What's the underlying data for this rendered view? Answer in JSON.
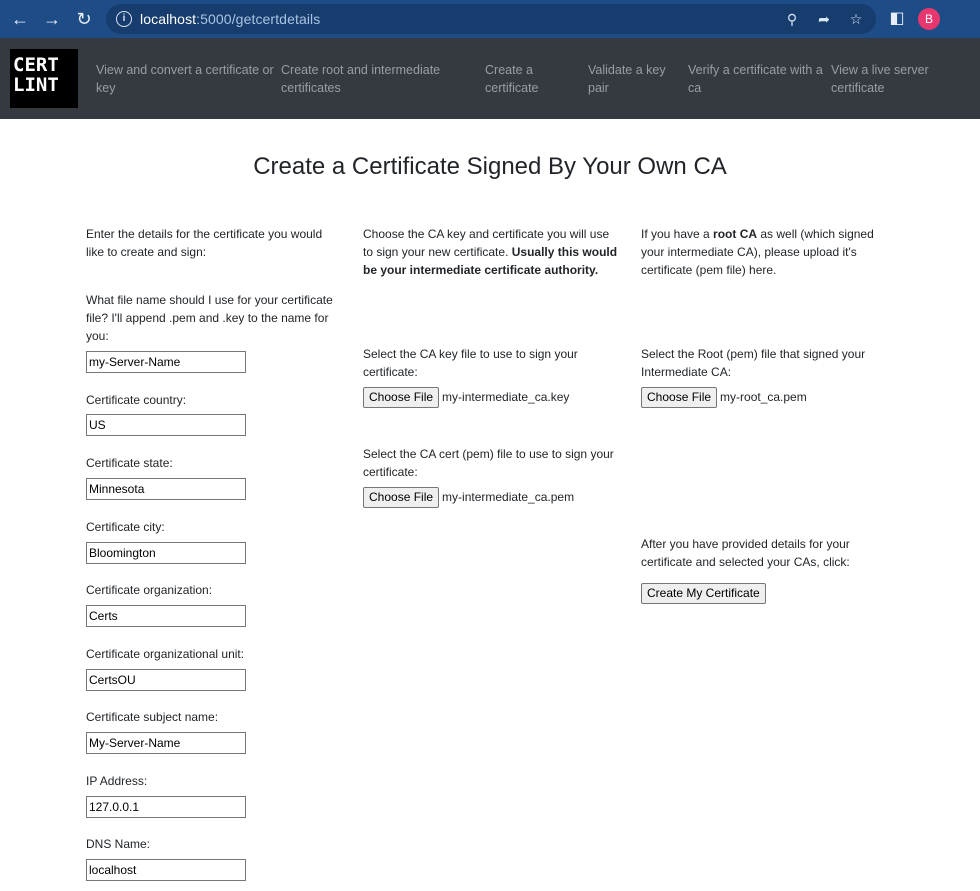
{
  "browser": {
    "url_host": "localhost",
    "url_path": ":5000/getcertdetails",
    "icons": [
      "back-icon",
      "forward-icon",
      "reload-icon",
      "site-info-icon",
      "zoom-icon",
      "share-icon",
      "bookmark-star-icon",
      "side-panel-icon"
    ],
    "profile_initial": "B",
    "profile_color": "#e8376f",
    "chrome_color": "#1e4c86"
  },
  "navbar": {
    "logo_line1": "CERT",
    "logo_line2": "LINT",
    "links": [
      {
        "line1": "View and convert a certificate or",
        "line2": "key"
      },
      {
        "line1": "Create root and intermediate",
        "line2": "certificates"
      },
      {
        "line1": "Create a",
        "line2": "certificate"
      },
      {
        "line1": "Validate a key",
        "line2": "pair"
      },
      {
        "line1": "Verify a certificate with a",
        "line2": "ca"
      },
      {
        "line1": "View a live server",
        "line2": "certificate"
      }
    ],
    "background": "#343a40"
  },
  "page": {
    "title": "Create a Certificate Signed By Your Own CA"
  },
  "left": {
    "intro_l1": "Enter the details for the certificate you would",
    "intro_l2": "like to create and sign:",
    "filename_l1": "What file name should I use for your certificate",
    "filename_l2": "file? I'll append .pem and .key to the name for",
    "filename_l3": "you:",
    "filename_value": "my-Server-Name",
    "fields": [
      {
        "label": "Certificate country:",
        "value": "US"
      },
      {
        "label": "Certificate state:",
        "value": "Minnesota"
      },
      {
        "label": "Certificate city:",
        "value": "Bloomington"
      },
      {
        "label": "Certificate organization:",
        "value": "Certs"
      },
      {
        "label": "Certificate organizational unit:",
        "value": "CertsOU"
      },
      {
        "label": "Certificate subject name:",
        "value": "My-Server-Name"
      },
      {
        "label": "IP Address:",
        "value": "127.0.0.1"
      },
      {
        "label": "DNS Name:",
        "value": "localhost"
      }
    ]
  },
  "middle": {
    "intro_l1": "Choose the CA key and certificate you will use",
    "intro_l2a": "to sign your new certificate. ",
    "intro_l2b": "Usually this would",
    "intro_l3": "be your intermediate certificate authority.",
    "key_label_l1": "Select the CA key file to use to sign your",
    "key_label_l2": "certificate:",
    "key_button": "Choose File",
    "key_file": "my-intermediate_ca.key",
    "cert_label_l1": "Select the CA cert (pem) file to use to sign your",
    "cert_label_l2": "certificate:",
    "cert_button": "Choose File",
    "cert_file": "my-intermediate_ca.pem"
  },
  "right": {
    "intro_l1a": "If you have a ",
    "intro_l1b": "root CA",
    "intro_l1c": " as well (which signed",
    "intro_l2": "your intermediate CA), please upload it's",
    "intro_l3": "certificate (pem file) here.",
    "root_label_l1": "Select the Root (pem) file that signed your",
    "root_label_l2": "Intermediate CA:",
    "root_button": "Choose File",
    "root_file": "my-root_ca.pem",
    "submit_l1": "After you have provided details for your",
    "submit_l2": "certificate and selected your CAs, click:",
    "submit_button": "Create My Certificate"
  }
}
